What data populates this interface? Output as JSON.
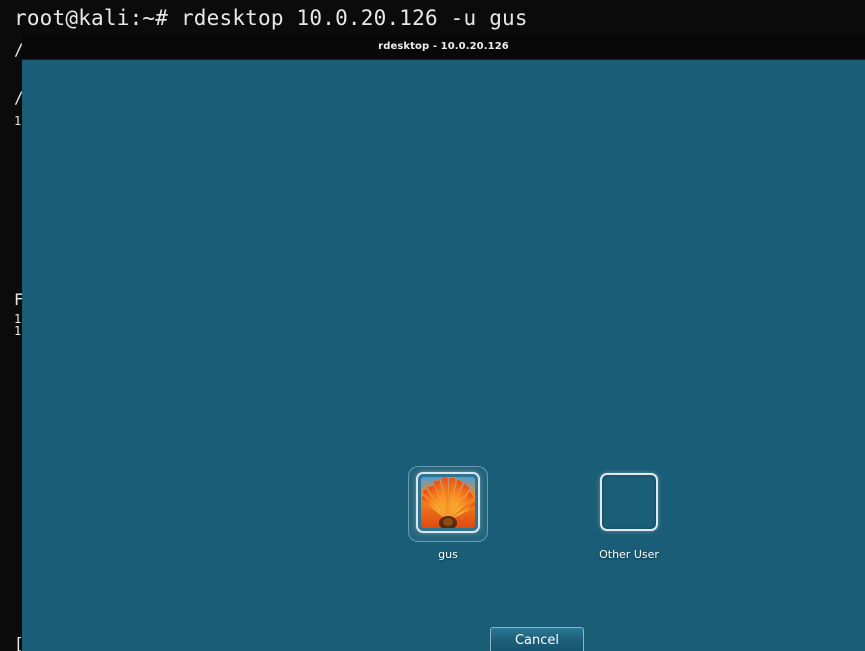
{
  "terminal": {
    "command_line": "root@kali:~# rdesktop 10.0.20.126 -u gus",
    "fragments": [
      "/",
      "/",
      "1",
      "F",
      "1",
      "1",
      "["
    ]
  },
  "window": {
    "title": "rdesktop - 10.0.20.126"
  },
  "logon": {
    "users": [
      {
        "name": "gus",
        "avatar": "flower-icon"
      },
      {
        "name": "Other User",
        "avatar": "blank-user-icon"
      }
    ],
    "cancel_label": "Cancel"
  },
  "colors": {
    "screen_bg": "#1a5d76",
    "titlebar_bg": "#080808",
    "terminal_bg": "#0b0b0b",
    "terminal_text": "#e8e8e8"
  }
}
